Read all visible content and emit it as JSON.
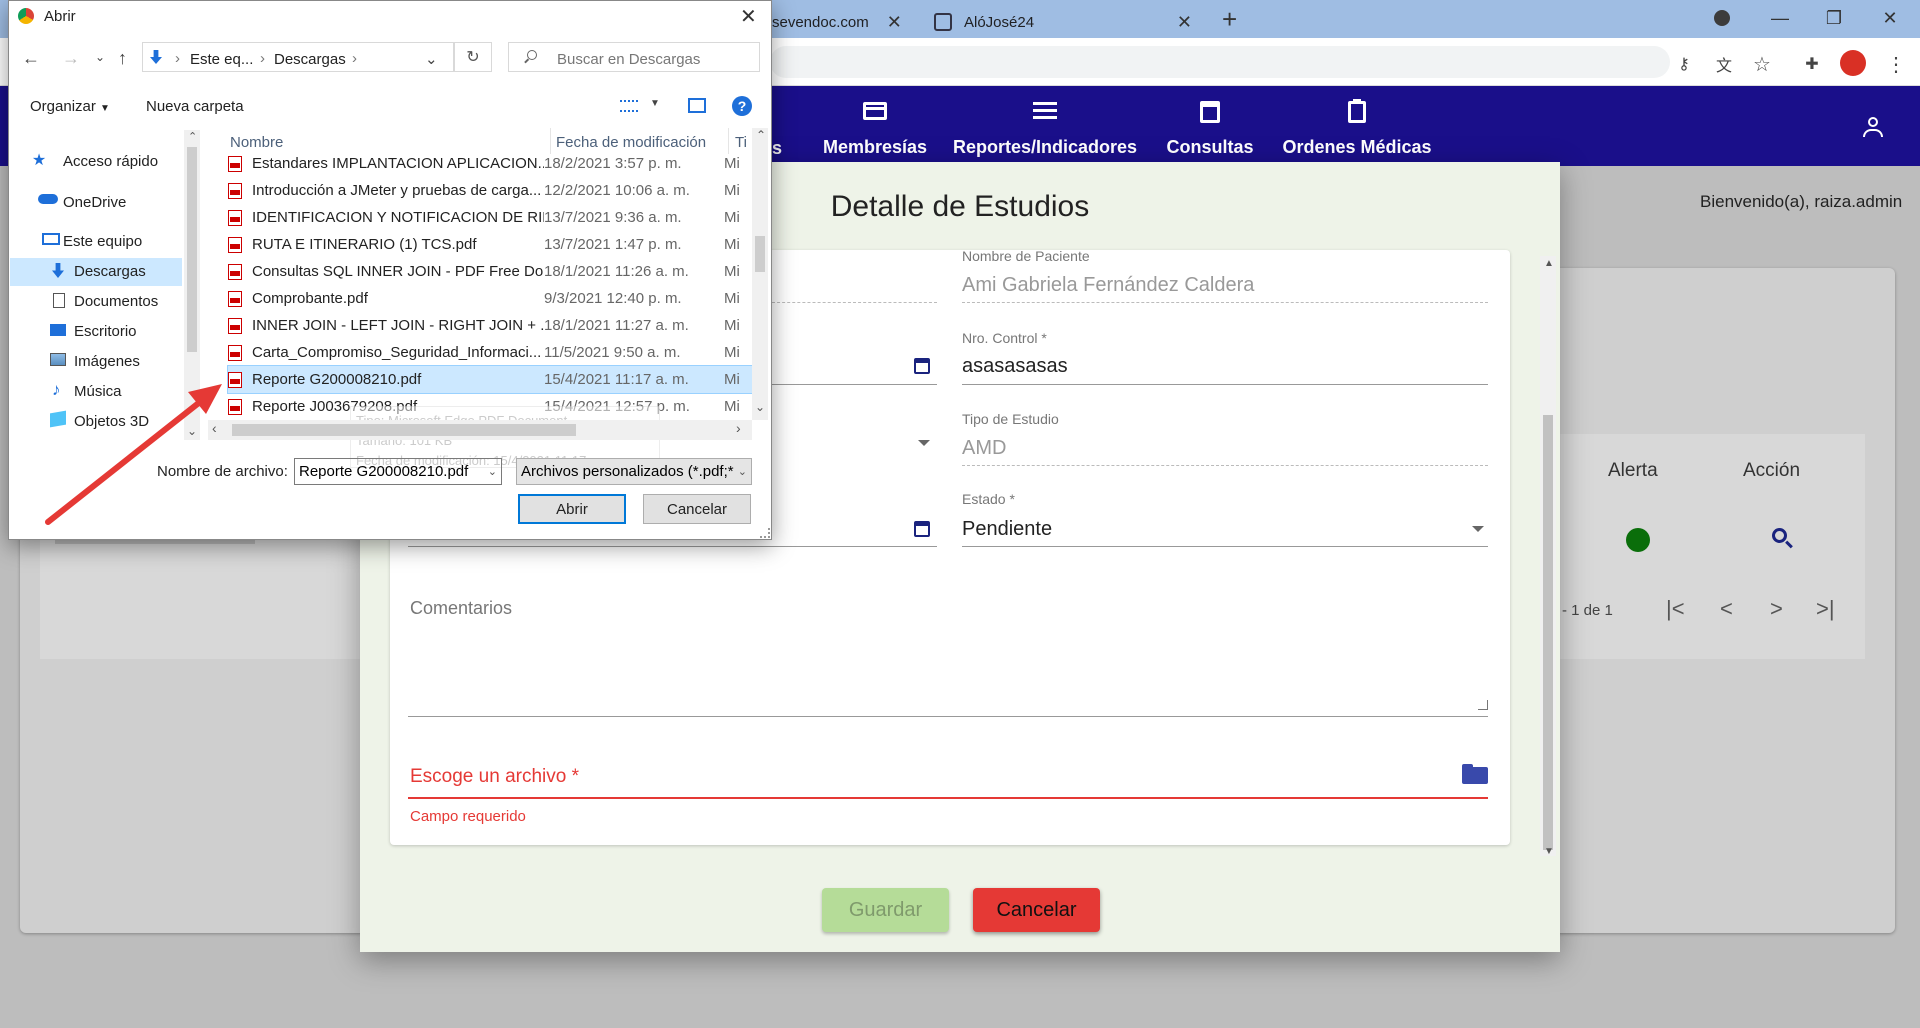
{
  "browser": {
    "tabs": [
      {
        "title": "sevendoc.com"
      },
      {
        "title": "AlóJosé24"
      }
    ],
    "new_tab": "+"
  },
  "app": {
    "nav": [
      {
        "label": "Membresías"
      },
      {
        "label": "Reportes/Indicadores"
      },
      {
        "label": "Consultas"
      },
      {
        "label": "Ordenes Médicas"
      }
    ],
    "partial_nav": "s",
    "welcome": "Bienvenido(a), raiza.admin",
    "table": {
      "headers": [
        "Alerta",
        "Acción"
      ],
      "pagination": "- 1 de 1"
    }
  },
  "modal": {
    "title": "Detalle de Estudios",
    "fields": {
      "patient_label": "Nombre de Paciente",
      "patient_value": "Ami Gabriela Fernández Caldera",
      "control_label": "Nro. Control *",
      "control_value": "asasasasas",
      "study_label": "Tipo de Estudio",
      "study_value": "AMD",
      "status_label": "Estado *",
      "status_value": "Pendiente",
      "comments_label": "Comentarios",
      "file_label": "Escoge un archivo *",
      "file_error": "Campo requerido"
    },
    "buttons": {
      "save": "Guardar",
      "cancel": "Cancelar"
    }
  },
  "dialog": {
    "title": "Abrir",
    "breadcrumb": [
      "Este eq...",
      "Descargas"
    ],
    "search_placeholder": "Buscar en Descargas",
    "toolbar": {
      "organize": "Organizar",
      "new_folder": "Nueva carpeta"
    },
    "nav": [
      "Acceso rápido",
      "OneDrive",
      "Este equipo",
      "Descargas",
      "Documentos",
      "Escritorio",
      "Imágenes",
      "Música",
      "Objetos 3D"
    ],
    "columns": {
      "name": "Nombre",
      "date": "Fecha de modificación",
      "type": "Ti"
    },
    "files": [
      {
        "name": "Estandares IMPLANTACION APLICACION...",
        "date": "18/2/2021 3:57 p. m.",
        "type": "Mi"
      },
      {
        "name": "Introducción a JMeter y pruebas de carga...",
        "date": "12/2/2021 10:06 a. m.",
        "type": "Mi"
      },
      {
        "name": "IDENTIFICACION Y NOTIFICACION DE RIE...",
        "date": "13/7/2021 9:36 a. m.",
        "type": "Mi"
      },
      {
        "name": "RUTA E ITINERARIO (1) TCS.pdf",
        "date": "13/7/2021 1:47 p. m.",
        "type": "Mi"
      },
      {
        "name": "Consultas SQL INNER JOIN - PDF Free Do...",
        "date": "18/1/2021 11:26 a. m.",
        "type": "Mi"
      },
      {
        "name": "Comprobante.pdf",
        "date": "9/3/2021 12:40 p. m.",
        "type": "Mi"
      },
      {
        "name": "INNER JOIN - LEFT JOIN - RIGHT JOIN + ...",
        "date": "18/1/2021 11:27 a. m.",
        "type": "Mi"
      },
      {
        "name": "Carta_Compromiso_Seguridad_Informaci...",
        "date": "11/5/2021 9:50 a. m.",
        "type": "Mi"
      },
      {
        "name": "Reporte G200008210.pdf",
        "date": "15/4/2021 11:17 a. m.",
        "type": "Mi"
      },
      {
        "name": "Reporte J003679208.pdf",
        "date": "15/4/2021 12:57 p. m.",
        "type": "Mi"
      }
    ],
    "tooltip": [
      "Tipo: Microsoft Edge PDF Document",
      "Tamaño: 101 KB",
      "Fecha de modificación: 15/4/2021 11:17 a. m."
    ],
    "filename_label": "Nombre de archivo:",
    "filename_value": "Reporte G200008210.pdf",
    "filter_value": "Archivos personalizados (*.pdf;*",
    "open": "Abrir",
    "cancel": "Cancelar"
  }
}
